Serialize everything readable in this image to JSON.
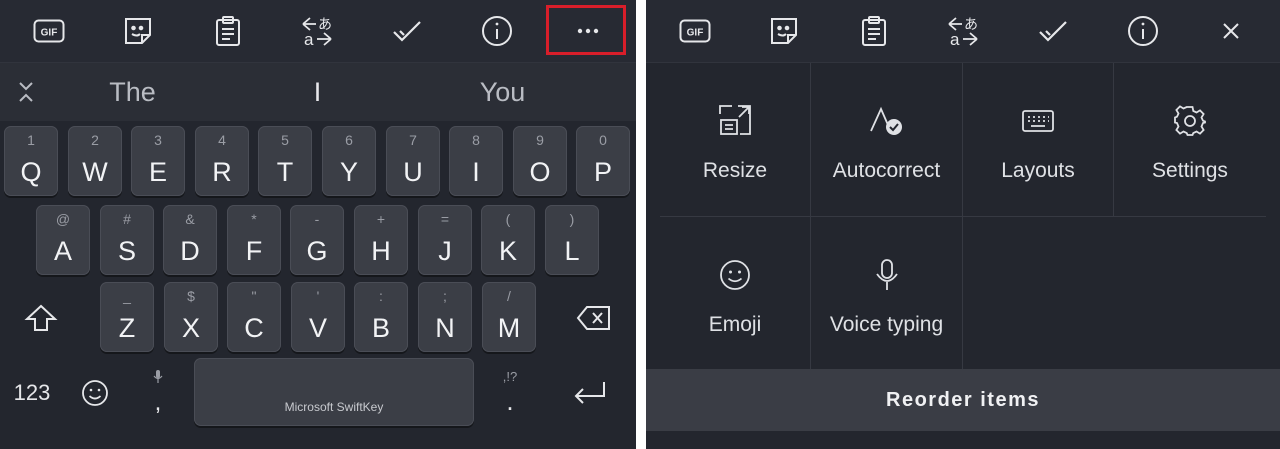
{
  "toolbar": {
    "gif_label": "GIF",
    "icons": [
      "gif-icon",
      "sticker-icon",
      "clipboard-icon",
      "translate-icon",
      "checkmark-icon",
      "info-icon"
    ],
    "more_icon": "more-dots-icon",
    "close_icon": "close-icon",
    "highlight_color": "#d81e2a"
  },
  "suggestions": [
    "The",
    "I",
    "You"
  ],
  "keyboard": {
    "row1": [
      {
        "hint": "1",
        "key": "Q"
      },
      {
        "hint": "2",
        "key": "W"
      },
      {
        "hint": "3",
        "key": "E"
      },
      {
        "hint": "4",
        "key": "R"
      },
      {
        "hint": "5",
        "key": "T"
      },
      {
        "hint": "6",
        "key": "Y"
      },
      {
        "hint": "7",
        "key": "U"
      },
      {
        "hint": "8",
        "key": "I"
      },
      {
        "hint": "9",
        "key": "O"
      },
      {
        "hint": "0",
        "key": "P"
      }
    ],
    "row2": [
      {
        "hint": "@",
        "key": "A"
      },
      {
        "hint": "#",
        "key": "S"
      },
      {
        "hint": "&",
        "key": "D"
      },
      {
        "hint": "*",
        "key": "F"
      },
      {
        "hint": "-",
        "key": "G"
      },
      {
        "hint": "+",
        "key": "H"
      },
      {
        "hint": "=",
        "key": "J"
      },
      {
        "hint": "(",
        "key": "K"
      },
      {
        "hint": ")",
        "key": "L"
      }
    ],
    "row3": [
      {
        "hint": "_",
        "key": "Z"
      },
      {
        "hint": "$",
        "key": "X"
      },
      {
        "hint": "\"",
        "key": "C"
      },
      {
        "hint": "'",
        "key": "V"
      },
      {
        "hint": ":",
        "key": "B"
      },
      {
        "hint": ";",
        "key": "N"
      },
      {
        "hint": "/",
        "key": "M"
      }
    ],
    "numbers_label": "123",
    "comma": ",",
    "period_hint": ",!?",
    "period": ".",
    "space_label": "Microsoft SwiftKey"
  },
  "menu": {
    "items": [
      {
        "label": "Resize",
        "icon": "resize-icon"
      },
      {
        "label": "Autocorrect",
        "icon": "autocorrect-icon"
      },
      {
        "label": "Layouts",
        "icon": "keyboard-layout-icon"
      },
      {
        "label": "Settings",
        "icon": "gear-icon"
      },
      {
        "label": "Emoji",
        "icon": "emoji-icon"
      },
      {
        "label": "Voice typing",
        "icon": "microphone-icon"
      }
    ],
    "reorder_label": "Reorder items"
  }
}
